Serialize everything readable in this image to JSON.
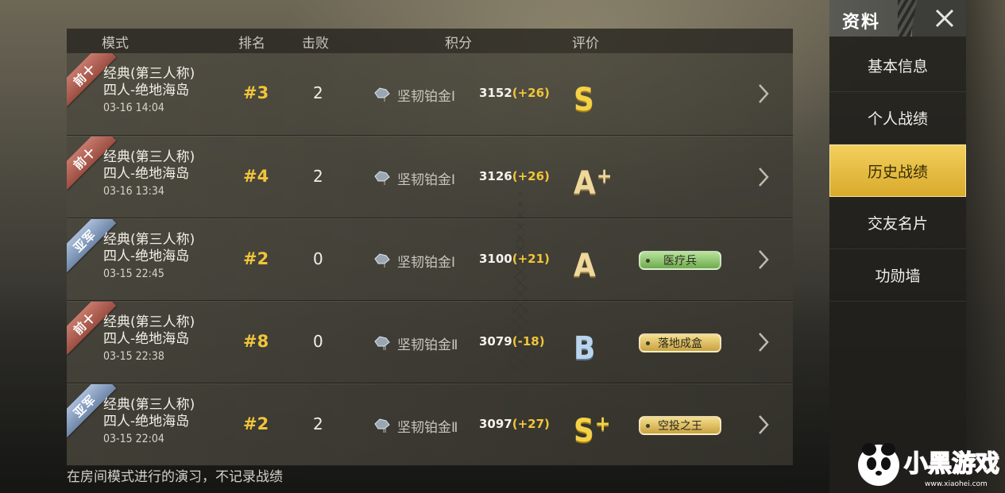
{
  "header": {
    "mode": "模式",
    "rank": "排名",
    "kills": "击败",
    "score": "积分",
    "grade": "评价"
  },
  "rows": [
    {
      "ribbon": "前十",
      "ribbon_type": "top10",
      "mode_line1": "经典(第三人称)",
      "mode_line2": "四人-绝地海岛",
      "date": "03-16 14:04",
      "rank": "#3",
      "kills": "2",
      "tier": "坚韧铂金Ⅰ",
      "score": "3152",
      "delta": "(+26)",
      "grade": "S",
      "grade_plus": "",
      "badge": ""
    },
    {
      "ribbon": "前十",
      "ribbon_type": "top10",
      "mode_line1": "经典(第三人称)",
      "mode_line2": "四人-绝地海岛",
      "date": "03-16 13:34",
      "rank": "#4",
      "kills": "2",
      "tier": "坚韧铂金Ⅰ",
      "score": "3126",
      "delta": "(+26)",
      "grade": "A",
      "grade_plus": "+",
      "badge": ""
    },
    {
      "ribbon": "亚军",
      "ribbon_type": "second",
      "mode_line1": "经典(第三人称)",
      "mode_line2": "四人-绝地海岛",
      "date": "03-15 22:45",
      "rank": "#2",
      "kills": "0",
      "tier": "坚韧铂金Ⅰ",
      "score": "3100",
      "delta": "(+21)",
      "grade": "A",
      "grade_plus": "",
      "badge": "医疗兵"
    },
    {
      "ribbon": "前十",
      "ribbon_type": "top10",
      "mode_line1": "经典(第三人称)",
      "mode_line2": "四人-绝地海岛",
      "date": "03-15 22:38",
      "rank": "#8",
      "kills": "0",
      "tier": "坚韧铂金Ⅱ",
      "score": "3079",
      "delta": "(-18)",
      "grade": "B",
      "grade_plus": "",
      "badge": "落地成盒"
    },
    {
      "ribbon": "亚军",
      "ribbon_type": "second",
      "mode_line1": "经典(第三人称)",
      "mode_line2": "四人-绝地海岛",
      "date": "03-15 22:04",
      "rank": "#2",
      "kills": "2",
      "tier": "坚韧铂金Ⅱ",
      "score": "3097",
      "delta": "(+27)",
      "grade": "S",
      "grade_plus": "+",
      "badge": "空投之王"
    }
  ],
  "footer_note": "在房间模式进行的演习，不记录战绩",
  "panel": {
    "title": "资料",
    "items": [
      {
        "label": "基本信息"
      },
      {
        "label": "个人战绩"
      },
      {
        "label": "历史战绩",
        "active": true
      },
      {
        "label": "交友名片"
      },
      {
        "label": "功勋墙"
      }
    ]
  },
  "watermark": {
    "brand": "小黑游戏",
    "url": "www.xiaohei.com"
  },
  "colors": {
    "accent_gold": "#f0c53a",
    "active_tab": "#e8bd3f",
    "ribbon_top10": "#b0604f",
    "ribbon_second": "#8aa0c2",
    "badge_green": "#8cc46a",
    "badge_gold": "#dfbe5c"
  }
}
